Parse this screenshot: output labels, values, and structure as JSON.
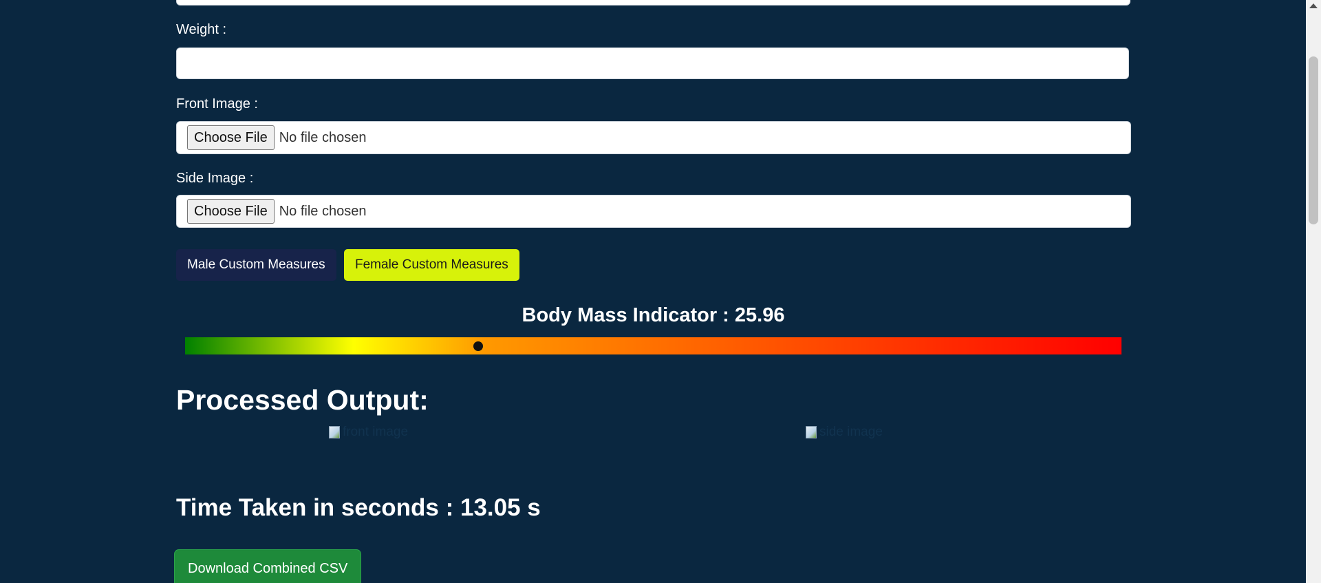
{
  "form": {
    "weight_label": "Weight :",
    "weight_value": "",
    "front_image_label": "Front Image :",
    "side_image_label": "Side Image :",
    "file_button_label": "Choose File",
    "file_status": "No file chosen"
  },
  "measures": {
    "male_label": "Male Custom Measures",
    "female_label": "Female Custom Measures"
  },
  "bmi": {
    "title": "Body Mass Indicator : 25.96",
    "value": 25.96,
    "gradient_colors": [
      "#008000",
      "#ffff00",
      "#ff9900",
      "#ff0000"
    ],
    "marker_color": "#111111"
  },
  "output": {
    "heading": "Processed Output:",
    "front_image_alt": "front image",
    "side_image_alt": "side image"
  },
  "timing": {
    "label": "Time Taken in seconds : 13.05 s"
  },
  "actions": {
    "download_label": "Download Combined CSV"
  },
  "colors": {
    "background": "#0a2740",
    "male_button": "#17234a",
    "female_button": "#d7f20a",
    "download_button": "#1e8a3a"
  }
}
